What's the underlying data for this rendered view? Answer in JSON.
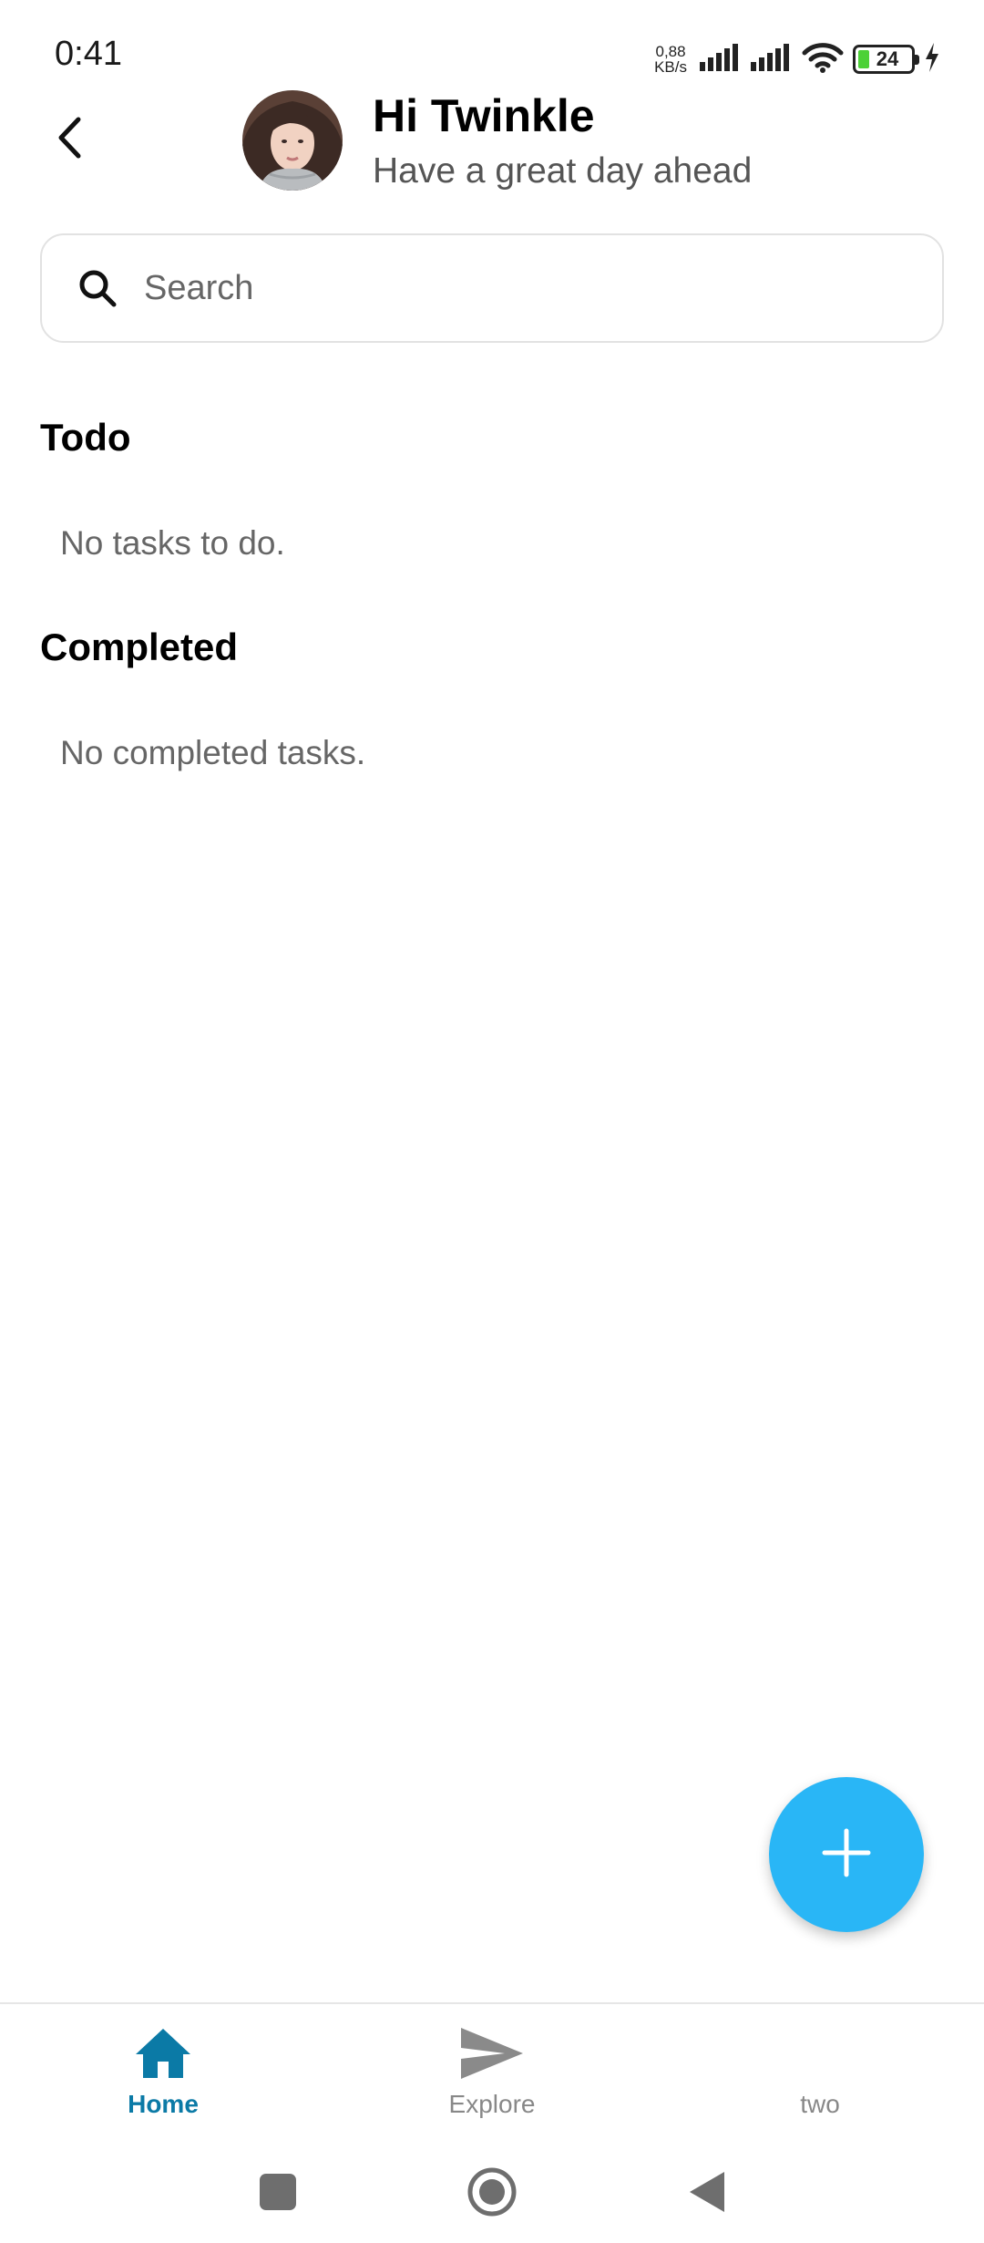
{
  "status_bar": {
    "time": "0:41",
    "net_speed_value": "0,88",
    "net_speed_unit": "KB/s",
    "battery_level": "24",
    "battery_accent": "#4cd137"
  },
  "header": {
    "title": "Hi Twinkle",
    "subtitle": "Have a great day ahead"
  },
  "search": {
    "placeholder": "Search",
    "value": ""
  },
  "sections": {
    "todo": {
      "title": "Todo",
      "empty_text": "No tasks to do."
    },
    "completed": {
      "title": "Completed",
      "empty_text": "No completed tasks."
    }
  },
  "fab": {
    "icon": "plus-icon",
    "color": "#29b6f6"
  },
  "bottom_nav": {
    "items": [
      {
        "label": "Home",
        "icon": "home-icon",
        "active": true
      },
      {
        "label": "Explore",
        "icon": "send-icon",
        "active": false
      },
      {
        "label": "two",
        "icon": "",
        "active": false
      }
    ],
    "active_color": "#0b7aa6"
  },
  "system_nav": {
    "buttons": [
      "recents-button",
      "home-button",
      "back-button"
    ]
  }
}
